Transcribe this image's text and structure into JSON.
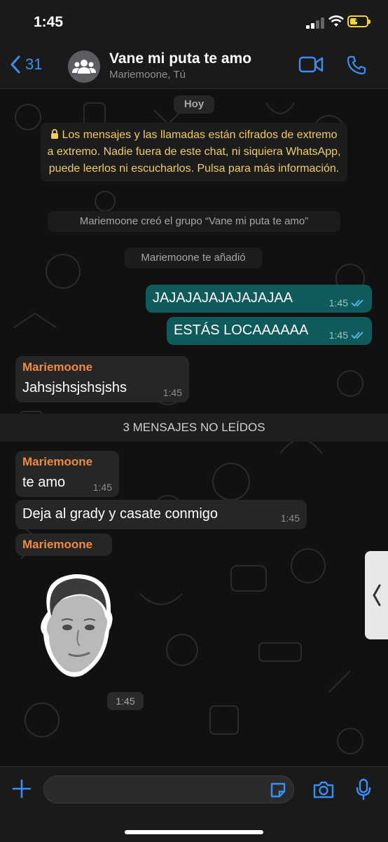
{
  "status_bar": {
    "time": "1:45"
  },
  "header": {
    "back_count": "31",
    "title": "Vane mi puta te amo",
    "subtitle": "Mariemoone, Tú"
  },
  "chat": {
    "date_label": "Hoy",
    "encryption_notice": "Los mensajes y las llamadas están cifrados de extremo a extremo. Nadie fuera de este chat, ni siquiera WhatsApp, puede leerlos ni escucharlos. Pulsa para más información.",
    "system_created": "Mariemoone creó el grupo “Vane mi puta te amo”",
    "system_added": "Mariemoone te añadió",
    "outgoing": [
      {
        "text": "JAJAJAJAJAJAJAJAA",
        "time": "1:45"
      },
      {
        "text": "ESTÁS LOCAAAAAA",
        "time": "1:45"
      }
    ],
    "incoming_1": {
      "sender": "Mariemoone",
      "text": "Jahsjshsjshsjshs",
      "time": "1:45"
    },
    "unread_banner": "3 MENSAJES NO LEÍDOS",
    "incoming_2": {
      "sender": "Mariemoone",
      "text": "te amo",
      "time": "1:45"
    },
    "incoming_3": {
      "text": "Deja al grady y casate conmigo",
      "time": "1:45"
    },
    "incoming_4": {
      "sender": "Mariemoone",
      "sticker_time": "1:45"
    }
  },
  "input": {
    "value": ""
  },
  "colors": {
    "accent": "#3a8ef6",
    "sender_name": "#f08a3a",
    "outgoing_bubble": "#0f5a5a",
    "incoming_bubble": "#262626",
    "encryption_text": "#f2cd5b",
    "read_ticks": "#53bdeb"
  },
  "icons": [
    "back-chevron-icon",
    "group-avatar-icon",
    "video-call-icon",
    "phone-icon",
    "read-ticks-icon",
    "plus-icon",
    "sticker-icon",
    "camera-icon",
    "microphone-icon",
    "chevron-left-icon",
    "lock-icon"
  ]
}
